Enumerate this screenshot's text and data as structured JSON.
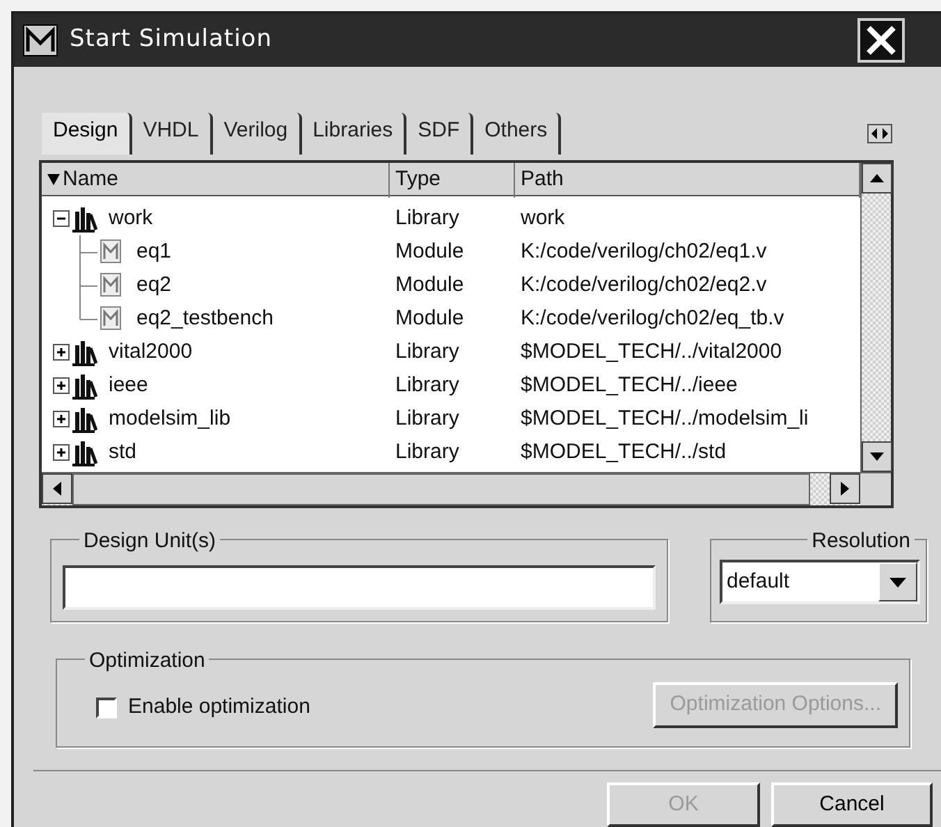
{
  "window": {
    "title": "Start Simulation"
  },
  "tabs": [
    {
      "label": "Design",
      "selected": true
    },
    {
      "label": "VHDL",
      "selected": false
    },
    {
      "label": "Verilog",
      "selected": false
    },
    {
      "label": "Libraries",
      "selected": false
    },
    {
      "label": "SDF",
      "selected": false
    },
    {
      "label": "Others",
      "selected": false
    }
  ],
  "table": {
    "columns": [
      "Name",
      "Type",
      "Path"
    ],
    "rows": [
      {
        "kind": "library",
        "name": "work",
        "type": "Library",
        "path": "work",
        "expanded": true,
        "children": [
          {
            "kind": "module",
            "name": "eq1",
            "type": "Module",
            "path": "K:/code/verilog/ch02/eq1.v"
          },
          {
            "kind": "module",
            "name": "eq2",
            "type": "Module",
            "path": "K:/code/verilog/ch02/eq2.v"
          },
          {
            "kind": "module",
            "name": "eq2_testbench",
            "type": "Module",
            "path": "K:/code/verilog/ch02/eq_tb.v"
          }
        ]
      },
      {
        "kind": "library",
        "name": "vital2000",
        "type": "Library",
        "path": "$MODEL_TECH/../vital2000",
        "expanded": false
      },
      {
        "kind": "library",
        "name": "ieee",
        "type": "Library",
        "path": "$MODEL_TECH/../ieee",
        "expanded": false
      },
      {
        "kind": "library",
        "name": "modelsim_lib",
        "type": "Library",
        "path": "$MODEL_TECH/../modelsim_li",
        "expanded": false
      },
      {
        "kind": "library",
        "name": "std",
        "type": "Library",
        "path": "$MODEL_TECH/../std",
        "expanded": false
      }
    ]
  },
  "design_units": {
    "label": "Design Unit(s)"
  },
  "resolution": {
    "label": "Resolution",
    "value": "default"
  },
  "optimization": {
    "label": "Optimization",
    "enable": {
      "label": "Enable optimization",
      "checked": false
    },
    "options_button": {
      "label": "Optimization Options...",
      "disabled": true
    }
  },
  "buttons": [
    {
      "label": "OK",
      "disabled": true
    },
    {
      "label": "Cancel",
      "disabled": false
    }
  ]
}
